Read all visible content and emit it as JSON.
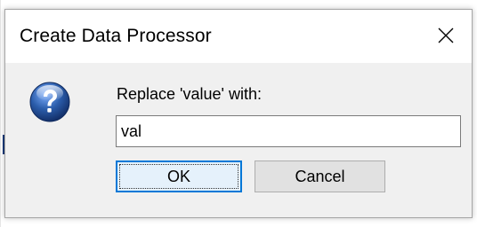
{
  "dialog": {
    "title": "Create Data Processor",
    "prompt": "Replace 'value' with:",
    "input_value": "val",
    "ok_label": "OK",
    "cancel_label": "Cancel"
  },
  "icons": {
    "close": "close-icon",
    "question": "question-icon"
  },
  "colors": {
    "accent_focus": "#0078d7",
    "dialog_bg": "#f0f0f0",
    "title_bg": "#ffffff",
    "icon_blue": "#2b5dab"
  }
}
